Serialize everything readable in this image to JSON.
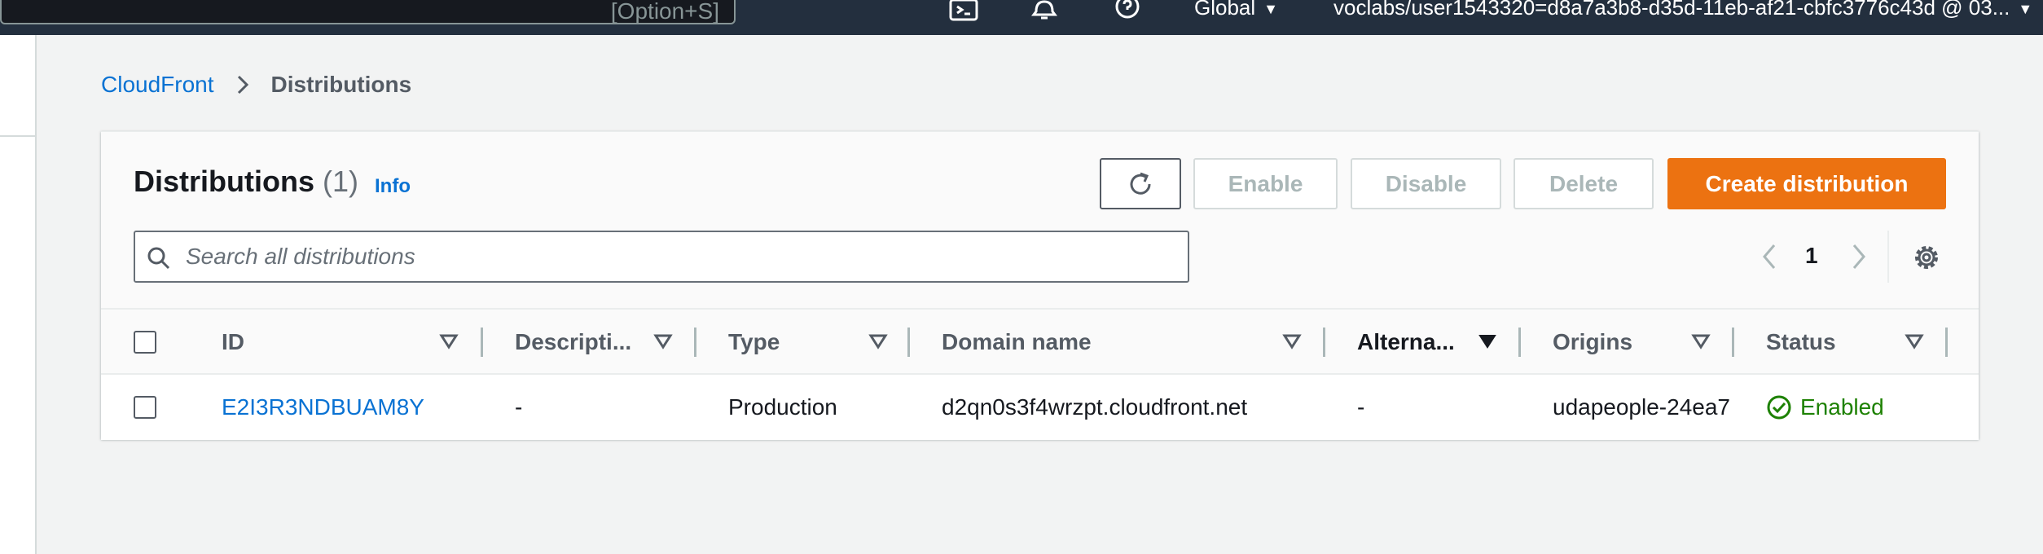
{
  "topnav": {
    "search_shortcut": "[Option+S]",
    "region": "Global",
    "account": "voclabs/user1543320=d8a7a3b8-d35d-11eb-af21-cbfc3776c43d @ 03...",
    "icons": [
      "cloudshell-icon",
      "bell-icon",
      "help-icon"
    ]
  },
  "breadcrumb": {
    "root": "CloudFront",
    "current": "Distributions"
  },
  "panel": {
    "title": "Distributions",
    "count": "(1)",
    "info_label": "Info",
    "buttons": {
      "enable": "Enable",
      "disable": "Disable",
      "delete": "Delete",
      "create": "Create distribution"
    },
    "search_placeholder": "Search all distributions",
    "page_number": "1"
  },
  "table": {
    "columns": {
      "id": "ID",
      "description": "Descripti...",
      "type": "Type",
      "domain": "Domain name",
      "alternate": "Alterna...",
      "origins": "Origins",
      "status": "Status"
    },
    "rows": [
      {
        "id": "E2I3R3NDBUAM8Y",
        "description": "-",
        "type": "Production",
        "domain": "d2qn0s3f4wrzpt.cloudfront.net",
        "alternate": "-",
        "origins": "udapeople-24ea7",
        "status": "Enabled"
      }
    ]
  },
  "colors": {
    "nav_bg": "#232f3e",
    "link": "#0972d3",
    "primary_button": "#ec7211",
    "status_success": "#1d8102"
  }
}
